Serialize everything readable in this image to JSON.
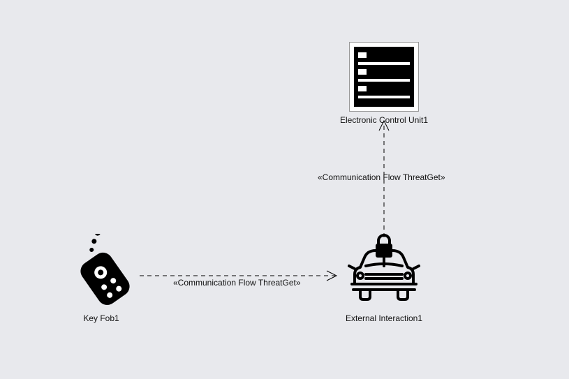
{
  "nodes": {
    "ecu": {
      "label": "Electronic Control Unit1"
    },
    "keyfob": {
      "label": "Key Fob1"
    },
    "external": {
      "label": "External Interaction1"
    }
  },
  "flows": {
    "keyfob_to_external": {
      "label": "«Communication Flow ThreatGet»"
    },
    "external_to_ecu": {
      "label": "«Communication Flow ThreatGet»"
    }
  }
}
